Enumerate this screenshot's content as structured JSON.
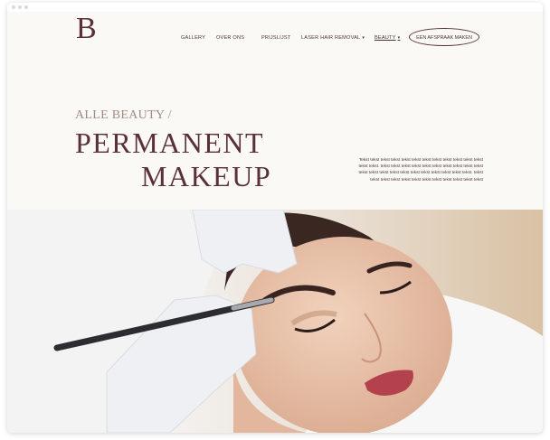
{
  "logo": {
    "text": "B"
  },
  "nav": {
    "items": [
      {
        "label": "GALLERY"
      },
      {
        "label": "OVER ONS"
      },
      {
        "label": "PRIJSLIJST"
      },
      {
        "label": "LASER HAIR REMOVAL",
        "has_dropdown": true
      },
      {
        "label": "BEAUTY",
        "has_dropdown": true,
        "active": true
      }
    ],
    "cta_label": "EEN AFSPRAAK MAKEN"
  },
  "hero": {
    "eyebrow": "ALLE BEAUTY /",
    "title_line1": "PERMANENT",
    "title_line2": "MAKEUP",
    "body": "Tekst tekst tekst tekst tekst tekst tekst tekst tekst tekst tekst tekst tekst tekst. tekst tekst tekst tekst tekst tekst tekst tekst tekst tekst tekst tekst tekst tekst tekst tekst tekst tekst tekst tekst tekst. tekst tekst tekst tekst tekst tekst tekst tekst tekst tekst tekst tekst"
  },
  "colors": {
    "brand": "#5b3139",
    "background": "#fbf9f5",
    "eyebrow": "#a08b84"
  }
}
